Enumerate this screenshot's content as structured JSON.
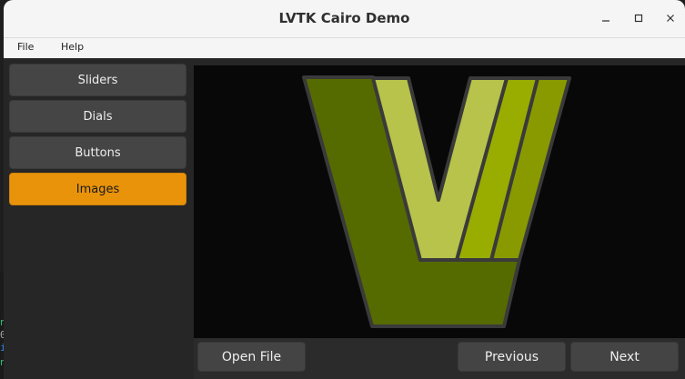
{
  "window": {
    "title": "LVTK Cairo Demo",
    "controls": [
      "minimize",
      "maximize",
      "close"
    ]
  },
  "menubar": {
    "items": [
      "File",
      "Help"
    ]
  },
  "sidebar": {
    "items": [
      {
        "label": "Sliders",
        "active": false
      },
      {
        "label": "Dials",
        "active": false
      },
      {
        "label": "Buttons",
        "active": false
      },
      {
        "label": "Images",
        "active": true
      }
    ]
  },
  "image_view": {
    "content": "LVTK logo (stylized V)"
  },
  "toolbar": {
    "open_file_label": "Open File",
    "previous_label": "Previous",
    "next_label": "Next"
  },
  "colors": {
    "accent": "#e8930a",
    "button": "#454545",
    "logo_dark": "#556b00",
    "logo_light": "#b7c34a",
    "logo_mid": "#99ac00",
    "logo_olive": "#889a00"
  }
}
